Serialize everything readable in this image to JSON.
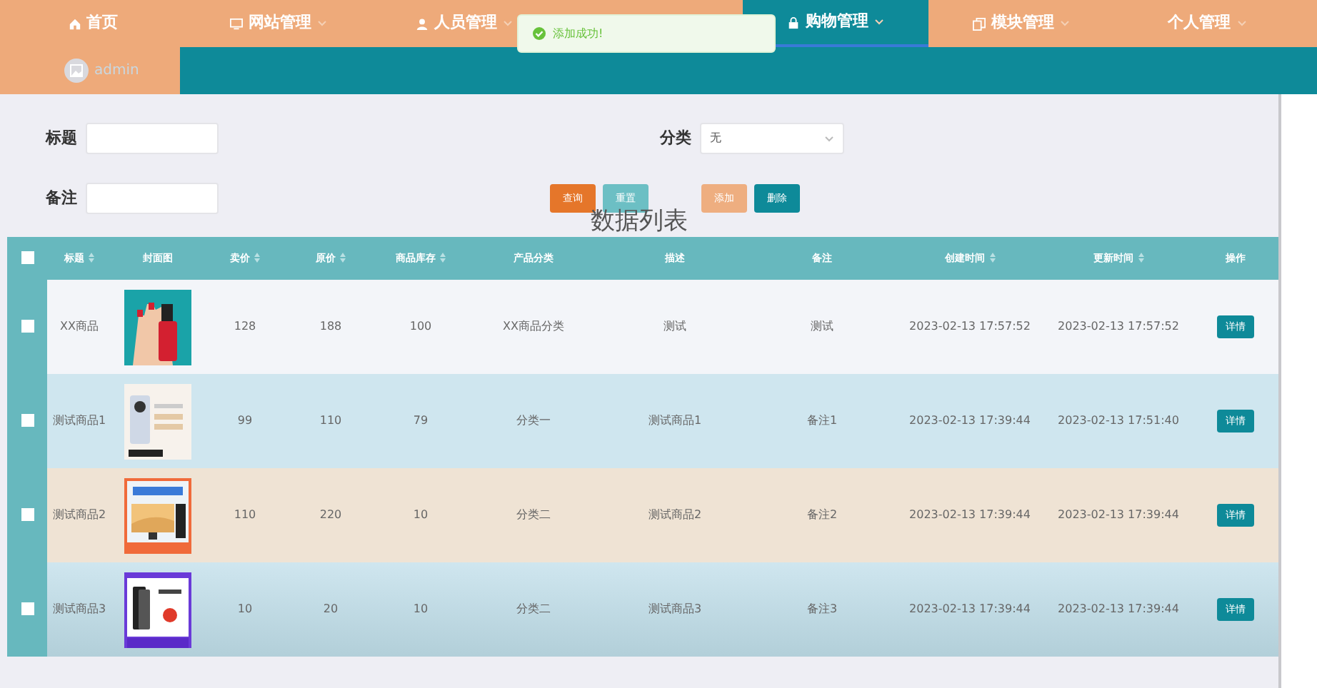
{
  "nav": [
    {
      "label": "首页",
      "caret": false,
      "selected": false
    },
    {
      "label": "网站管理",
      "caret": true,
      "selected": false
    },
    {
      "label": "人员管理",
      "caret": true,
      "selected": false
    },
    {
      "label": "购物管理",
      "caret": true,
      "selected": true
    },
    {
      "label": "模块管理",
      "caret": true,
      "selected": false
    },
    {
      "label": "个人管理",
      "caret": true,
      "selected": false
    }
  ],
  "user": {
    "name": "admin"
  },
  "toast": {
    "text": "添加成功!"
  },
  "search": {
    "fields": [
      {
        "label": "标题",
        "kind": "input"
      },
      {
        "label": "分类",
        "kind": "select",
        "value": "无"
      },
      {
        "label": "备注",
        "kind": "input"
      }
    ],
    "buttons": [
      {
        "label": "查询",
        "kind": "query"
      },
      {
        "label": "重置",
        "kind": "reset"
      },
      {
        "label": "添加",
        "kind": "add"
      },
      {
        "label": "删除",
        "kind": "delete"
      }
    ]
  },
  "table": {
    "title": "数据列表",
    "all_checked": false,
    "columns": [
      {
        "label": "标题",
        "sortable": true
      },
      {
        "label": "封面图",
        "sortable": false
      },
      {
        "label": "卖价",
        "sortable": true
      },
      {
        "label": "原价",
        "sortable": true
      },
      {
        "label": "商品库存",
        "sortable": true
      },
      {
        "label": "产品分类",
        "sortable": false
      },
      {
        "label": "描述",
        "sortable": false
      },
      {
        "label": "备注",
        "sortable": false
      },
      {
        "label": "创建时间",
        "sortable": true
      },
      {
        "label": "更新时间",
        "sortable": true
      },
      {
        "label": "操作",
        "sortable": false
      }
    ],
    "rows": [
      {
        "checked": false,
        "cells": [
          "XX商品",
          {
            "kind": "picture"
          },
          "128",
          "188",
          "100",
          "XX商品分类",
          "测试",
          "测试",
          "2023-02-13 17:57:52",
          "2023-02-13 17:57:52"
        ],
        "action": "详情"
      },
      {
        "checked": false,
        "cells": [
          "测试商品1",
          {
            "kind": "picture"
          },
          "99",
          "110",
          "79",
          "分类一",
          "测试商品1",
          "备注1",
          "2023-02-13 17:39:44",
          "2023-02-13 17:51:40"
        ],
        "action": "详情"
      },
      {
        "checked": false,
        "cells": [
          "测试商品2",
          {
            "kind": "picture"
          },
          "110",
          "220",
          "10",
          "分类二",
          "测试商品2",
          "备注2",
          "2023-02-13 17:39:44",
          "2023-02-13 17:39:44"
        ],
        "action": "详情"
      },
      {
        "checked": false,
        "cells": [
          "测试商品3",
          {
            "kind": "picture"
          },
          "10",
          "20",
          "10",
          "分类二",
          "测试商品3",
          "备注3",
          "2023-02-13 17:39:44",
          "2023-02-13 17:39:44"
        ],
        "action": "详情"
      }
    ]
  }
}
